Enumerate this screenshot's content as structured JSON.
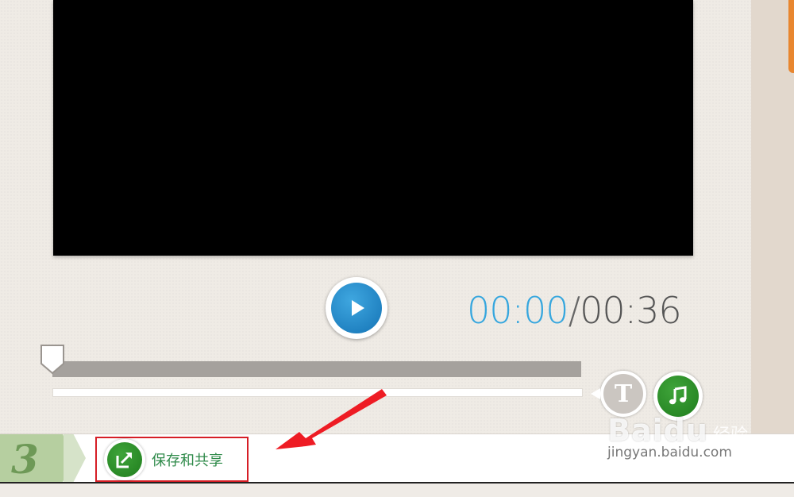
{
  "player": {
    "current_time": "00:00",
    "separator": "/",
    "total_time": "00:36",
    "progress_fraction": 0
  },
  "tools": {
    "text_button_glyph": "T",
    "music_button_icon": "music-note-icon"
  },
  "step": {
    "number": "3",
    "save_share_label": "保存和共享"
  },
  "watermark": {
    "brand": "Baidu",
    "suffix": "经验",
    "url": "jingyan.baidu.com"
  },
  "colors": {
    "accent_blue": "#35a6de",
    "accent_green": "#2f8a4a",
    "highlight_red": "#d61e26"
  }
}
